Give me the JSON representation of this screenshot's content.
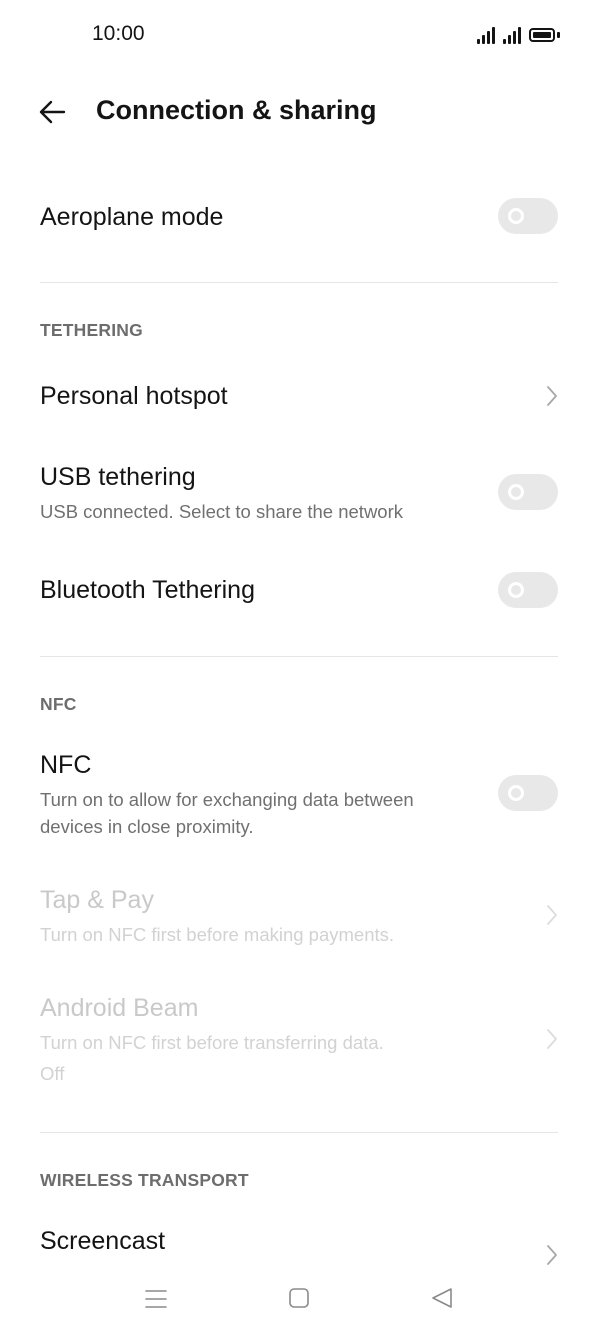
{
  "status_bar": {
    "time": "10:00"
  },
  "header": {
    "title": "Connection & sharing"
  },
  "aeroplane": {
    "label": "Aeroplane mode",
    "enabled": false
  },
  "tethering": {
    "section_label": "TETHERING",
    "personal_hotspot": {
      "label": "Personal hotspot"
    },
    "usb_tethering": {
      "label": "USB tethering",
      "subtitle": "USB connected. Select to share the network",
      "enabled": false
    },
    "bluetooth_tethering": {
      "label": "Bluetooth Tethering",
      "enabled": false
    }
  },
  "nfc": {
    "section_label": "NFC",
    "nfc_toggle": {
      "label": "NFC",
      "subtitle_line1": "Turn on to allow for exchanging data between",
      "subtitle_line2": "devices in close proximity.",
      "enabled": false
    },
    "tap_pay": {
      "label": "Tap & Pay",
      "subtitle": "Turn on NFC first before making payments."
    },
    "android_beam": {
      "label": "Android Beam",
      "subtitle": "Turn on NFC first before transferring data.",
      "status": "Off"
    }
  },
  "wireless_transport": {
    "section_label": "WIRELESS TRANSPORT",
    "screencast": {
      "label": "Screencast"
    }
  },
  "icons": {
    "back": "arrow-left-icon",
    "chevron": "chevron-right-icon",
    "nav_menu": "menu-icon",
    "nav_home": "square-icon",
    "nav_back": "triangle-back-icon"
  },
  "colors": {
    "text_primary": "#141414",
    "text_secondary": "#707070",
    "text_disabled": "#c9c9c9",
    "toggle_off": "#e8e8e8",
    "divider": "#e6e6e6"
  }
}
